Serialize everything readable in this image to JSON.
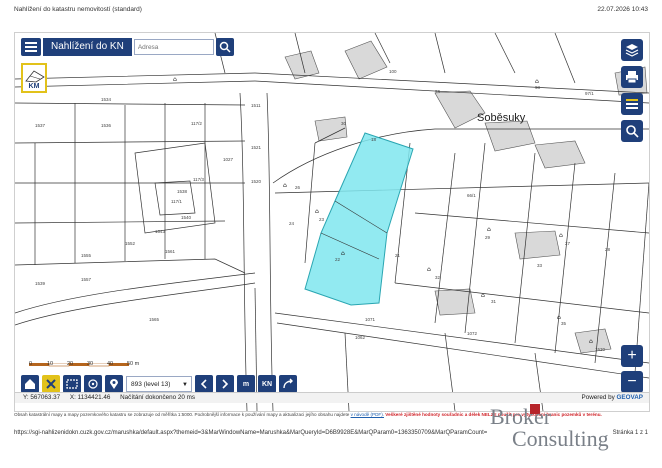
{
  "print_header": {
    "title": "Nahlížení do katastru nemovitostí (standard)",
    "datetime": "22.07.2026 10:43"
  },
  "app": {
    "brand": "Nahlížení do KN",
    "search_placeholder": "Adresa",
    "km_label": "KM",
    "accent_color": "#1f3f7a",
    "highlight_color": "#7fe6ee"
  },
  "map": {
    "place_label": "Soběsuky",
    "parcel_labels": [
      "1534",
      "1536",
      "1537",
      "1538",
      "1540",
      "1543",
      "1552",
      "1555",
      "1557",
      "1561",
      "1565",
      "117/2",
      "117/3",
      "117/1",
      "1027",
      "1511",
      "1521",
      "1520",
      "1539",
      "18",
      "21",
      "22",
      "23",
      "24",
      "26",
      "27",
      "28",
      "29",
      "30",
      "31",
      "32",
      "33",
      "35",
      "66/1",
      "97/1",
      "98",
      "99",
      "100",
      "1062",
      "1071",
      "1072",
      "1530"
    ],
    "building_symbol": "⌂"
  },
  "scale": {
    "labels": [
      "0",
      "10",
      "20",
      "30",
      "40",
      "50 m"
    ]
  },
  "toolbar": {
    "level_value": "893 (level 13)",
    "m_label": "m",
    "kn_label": "KN"
  },
  "status": {
    "y_coord": "Y: 567063.37",
    "x_coord": "X: 1134421.46",
    "load": "Načítání dokončeno 20 ms",
    "powered_prefix": "Powered by",
    "powered_brand": "GEOVAP"
  },
  "disclaimer": {
    "text": "Obsah katastrální mapy a mapy pozemkového katastru se zobrazuje od měřítka 1:5000. Podrobnější informace k používání mapy a aktualizaci jejího obsahu najdete",
    "link": "v návodě (PDF).",
    "warning": "Veškeré zjištěné hodnoty souřadnic a délek NELZE použít pro vytyčování hranic pozemků v terénu."
  },
  "footer": {
    "url": "https://sgi-nahlizenidokn.cuzk.gov.cz/marushka/default.aspx?themeid=3&MarWindowName=Marushka&MarQueryId=D6B9928E&MarQParam0=1363350709&MarQParamCount=",
    "page": "Stránka 1 z 1"
  },
  "watermark": {
    "line1": "Broker",
    "line2": "Consulting"
  }
}
